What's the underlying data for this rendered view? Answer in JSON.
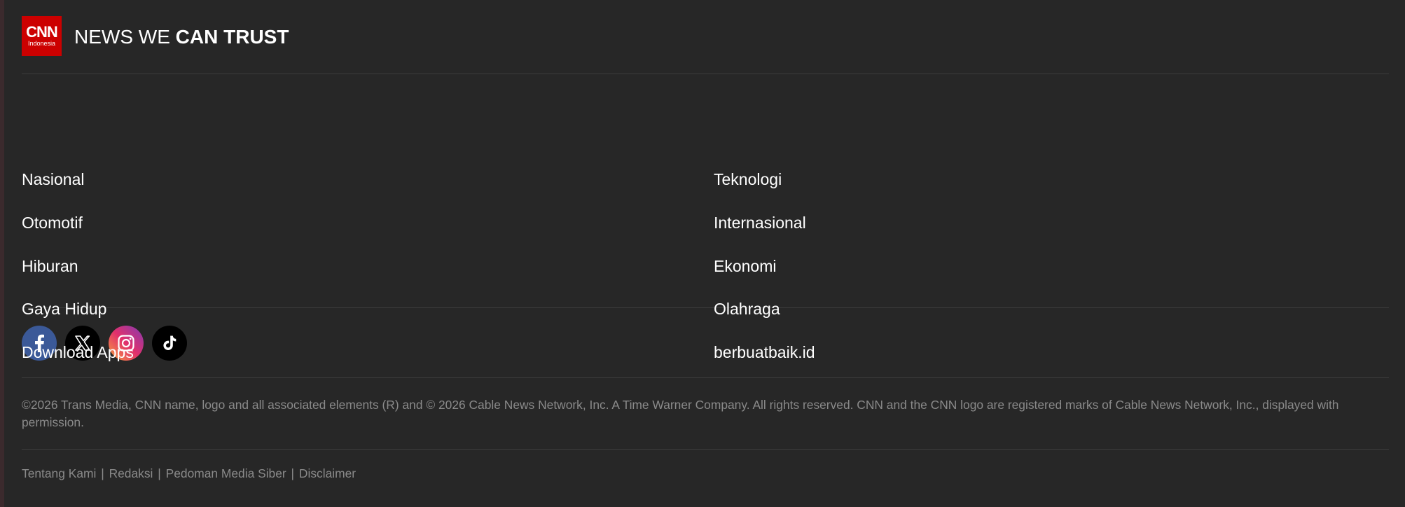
{
  "brand": {
    "logo_text": "CNN",
    "logo_subtext": "Indonesia",
    "tagline_regular": "NEWS WE ",
    "tagline_bold": "CAN TRUST",
    "logo_color": "#cc0000"
  },
  "nav": {
    "left": [
      "Nasional",
      "Otomotif",
      "Hiburan",
      "Gaya Hidup",
      "Download Apps"
    ],
    "right": [
      "Teknologi",
      "Internasional",
      "Ekonomi",
      "Olahraga",
      "berbuatbaik.id"
    ]
  },
  "social": [
    {
      "name": "facebook-icon",
      "color": "#3b5998"
    },
    {
      "name": "x-twitter-icon",
      "color": "#000000"
    },
    {
      "name": "instagram-icon",
      "color": "#e1306c"
    },
    {
      "name": "tiktok-icon",
      "color": "#000000"
    }
  ],
  "copyright": "©2026 Trans Media, CNN name, logo and all associated elements (R) and © 2026 Cable News Network, Inc. A Time Warner Company. All rights reserved. CNN and the CNN logo are registered marks of Cable News Network, Inc., displayed with permission.",
  "footer_links": [
    "Tentang Kami",
    "Redaksi",
    "Pedoman Media Siber",
    "Disclaimer"
  ],
  "separator": "|",
  "colors": {
    "background": "#272727",
    "text": "#ffffff",
    "muted_text": "#8a8a8a",
    "divider": "#3d3d3d"
  }
}
